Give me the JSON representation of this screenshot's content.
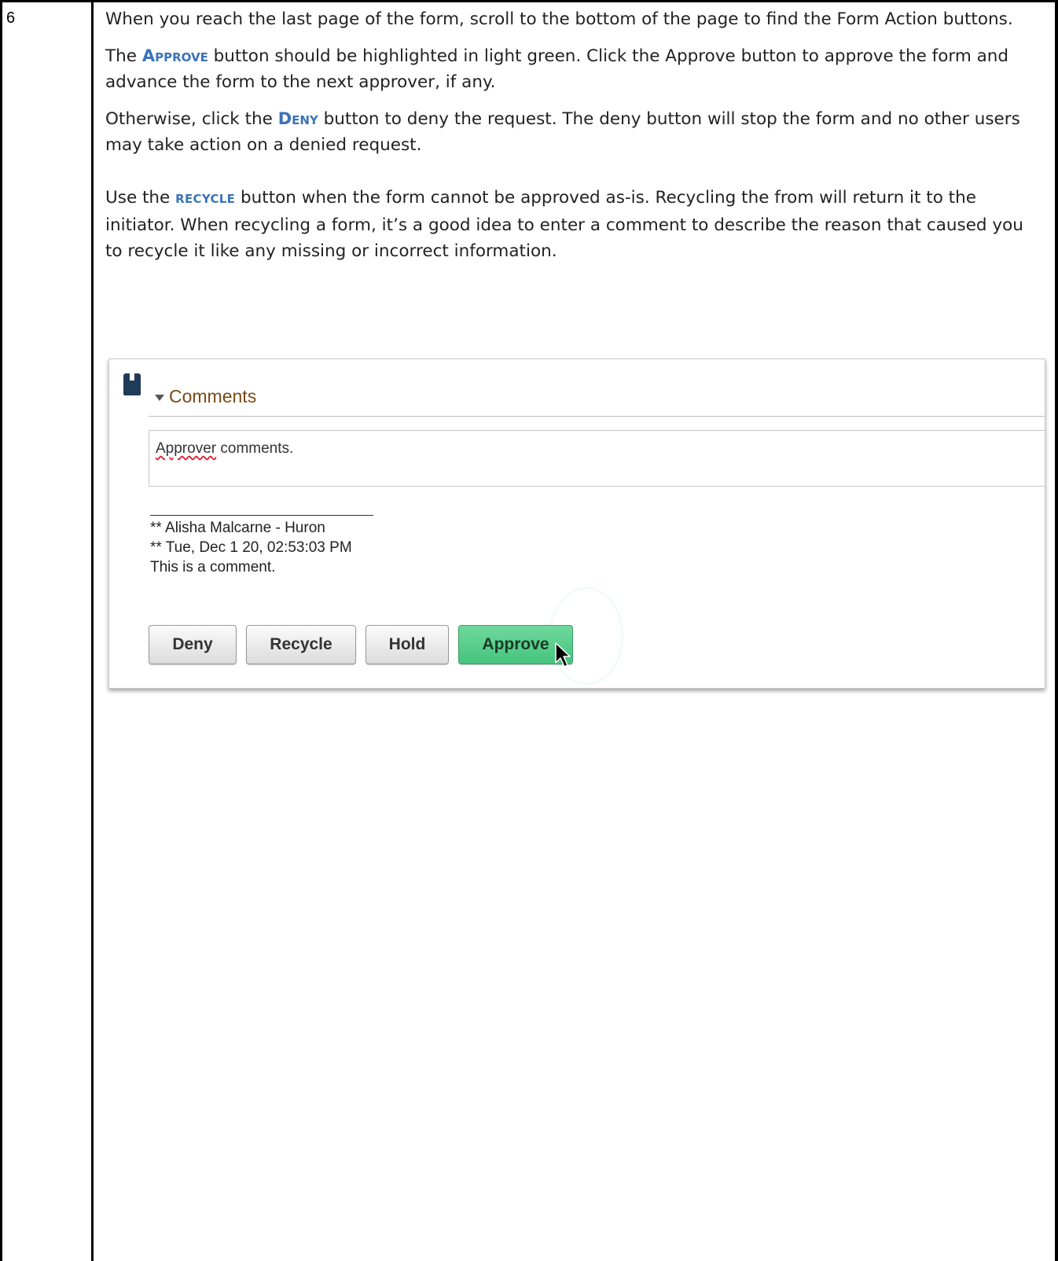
{
  "step": {
    "number": "6"
  },
  "instructions": {
    "p1": "When you reach the last page of the form, scroll to the bottom of the page to find the Form Action buttons.",
    "p2_pre": "The ",
    "p2_kw": "Approve",
    "p2_post": " button should be highlighted in light green. Click the Approve button to approve the form and advance the form to the next approver, if any.",
    "p3_pre": "Otherwise, click the ",
    "p3_kw": "Deny",
    "p3_post": " button to deny the request. The deny button will stop the form and no other users may take action on a denied request.",
    "p4_pre": "Use the ",
    "p4_kw": "RECYCLE",
    "p4_post": " button when the form cannot be approved as-is. Recycling the from will return it to the initiator. When recycling a form, it’s a good idea to enter a comment to describe the reason that caused you to recycle it like any missing or incorrect information."
  },
  "screenshot": {
    "section_title": "Comments",
    "comment_box": {
      "word1": "Approver",
      "rest": " comments."
    },
    "meta": {
      "line1": "** Alisha Malcarne - Huron",
      "line2": "** Tue, Dec 1 20, 02:53:03 PM",
      "line3": "This is a comment."
    },
    "buttons": {
      "deny": "Deny",
      "recycle": "Recycle",
      "hold": "Hold",
      "approve": "Approve"
    },
    "colors": {
      "approve": "#46c47f",
      "section_title": "#7a4a16",
      "keyword": "#3b73b9"
    }
  }
}
